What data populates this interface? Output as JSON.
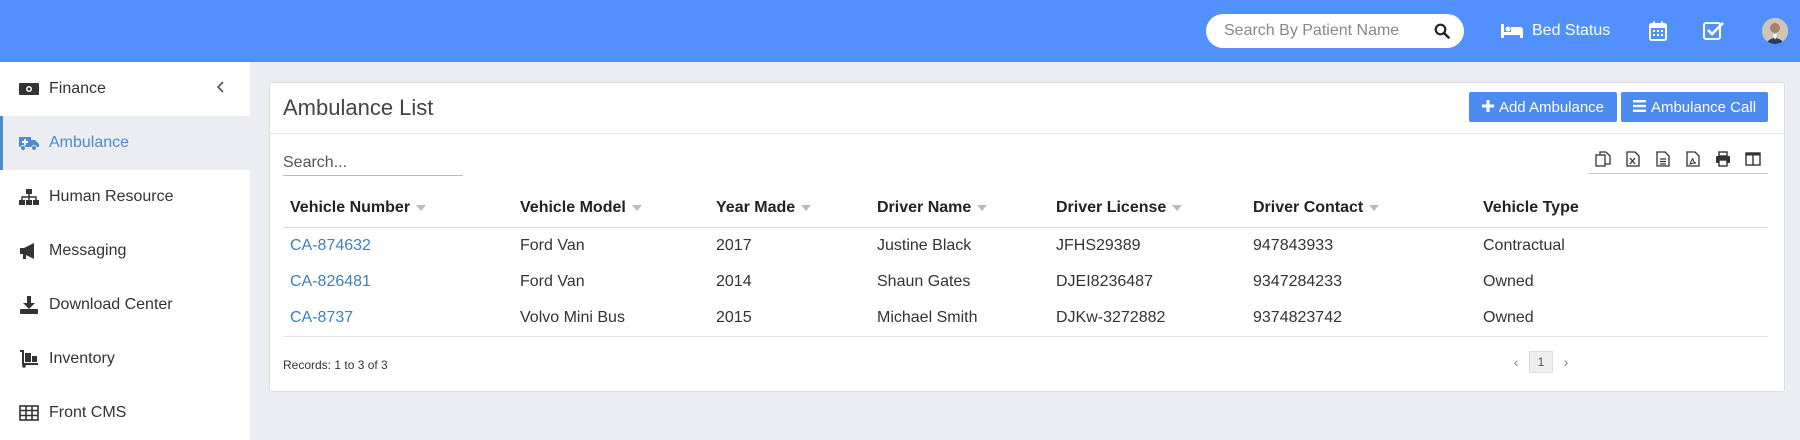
{
  "header": {
    "search_placeholder": "Search By Patient Name",
    "bed_status_label": "Bed Status",
    "bar_color": "#5290fd"
  },
  "sidebar": {
    "items": [
      {
        "label": "Finance",
        "icon": "money-icon"
      },
      {
        "label": "Ambulance",
        "icon": "ambulance-icon"
      },
      {
        "label": "Human Resource",
        "icon": "sitemap-icon"
      },
      {
        "label": "Messaging",
        "icon": "megaphone-icon"
      },
      {
        "label": "Download Center",
        "icon": "download-icon"
      },
      {
        "label": "Inventory",
        "icon": "dolly-icon"
      },
      {
        "label": "Front CMS",
        "icon": "grid-icon"
      }
    ]
  },
  "panel": {
    "title": "Ambulance List",
    "add_label": "Add Ambulance",
    "call_label": "Ambulance Call",
    "search_placeholder": "Search..."
  },
  "table": {
    "columns": [
      "Vehicle Number",
      "Vehicle Model",
      "Year Made",
      "Driver Name",
      "Driver License",
      "Driver Contact",
      "Vehicle Type"
    ],
    "rows": [
      [
        "CA-874632",
        "Ford Van",
        "2017",
        "Justine Black",
        "JFHS29389",
        "947843933",
        "Contractual"
      ],
      [
        "CA-826481",
        "Ford Van",
        "2014",
        "Shaun Gates",
        "DJEI8236487",
        "9347284233",
        "Owned"
      ],
      [
        "CA-8737",
        "Volvo Mini Bus",
        "2015",
        "Michael Smith",
        "DJKw-3272882",
        "9374823742",
        "Owned"
      ]
    ]
  },
  "footer": {
    "records": "Records: 1 to 3 of 3",
    "current_page": "1",
    "prev": "‹",
    "next": "›"
  },
  "colors": {
    "accent": "#4d8bf0",
    "link": "#3f7fbf",
    "active_menu": "#4d8bcf"
  }
}
